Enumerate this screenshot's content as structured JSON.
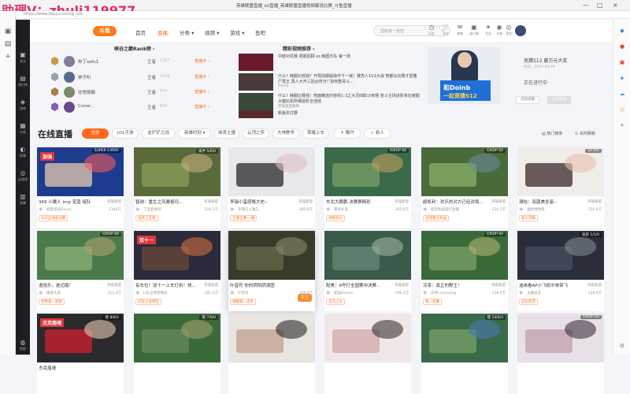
{
  "watermark": "助理V：zhuli119977",
  "window": {
    "title": "英雄联盟直播_lol直播_英雄联盟直播视频解说比赛_斗鱼直播",
    "controls": [
      "—",
      "□",
      "×"
    ]
  },
  "address": "https://www.douyu.com/g_LOL",
  "site_sidebar": [
    {
      "icon": "▣",
      "label": "关注"
    },
    {
      "icon": "▤",
      "label": "排行榜"
    },
    {
      "icon": "◈",
      "label": "游戏"
    },
    {
      "icon": "▦",
      "label": "分类"
    },
    {
      "icon": "◐",
      "label": "赛事"
    },
    {
      "icon": "◎",
      "label": "云游戏"
    },
    {
      "icon": "▥",
      "label": "直播"
    },
    {
      "icon": "◍",
      "label": "帮助"
    }
  ],
  "header": {
    "logo": "斗鱼",
    "nav": [
      {
        "label": "首页"
      },
      {
        "label": "直播"
      },
      {
        "label": "分类 ▾"
      },
      {
        "label": "视频 ▾"
      },
      {
        "label": "游戏 ▾"
      },
      {
        "label": "鱼吧"
      }
    ],
    "search_placeholder": "国服第一盲僧",
    "icons": [
      {
        "glyph": "◷",
        "label": "历史"
      },
      {
        "glyph": "♡",
        "label": "关注"
      },
      {
        "glyph": "✉",
        "label": "邮箱"
      },
      {
        "glyph": "▣",
        "label": "客户端"
      },
      {
        "glyph": "✦",
        "label": "任务"
      },
      {
        "glyph": "◉",
        "label": "开播"
      },
      {
        "glyph": "◎",
        "label": "游戏"
      }
    ]
  },
  "rank": {
    "title": "峡谷之巅Rank榜 ›",
    "rows": [
      {
        "name": "布丁sofu1",
        "tier": "王者",
        "points": "1357",
        "status": "直播中 ›"
      },
      {
        "name": "林子叭",
        "tier": "王者",
        "points": "1256",
        "status": "直播中 ›"
      },
      {
        "name": "壮悦旭毓",
        "tier": "王者",
        "points": "873",
        "status": "直播中 ›"
      },
      {
        "name": "Conor...",
        "tier": "王者",
        "points": "845",
        "status": "直播中 ›"
      }
    ]
  },
  "videos": {
    "title": "精彩视频推荐 ›",
    "items": [
      {
        "text": "中欧对抗赛 周期回顾 vs 韩国乐队 第一场",
        "channel": "英雄联盟赛事"
      },
      {
        "text": "什么？韩服比较强？开局前期猛操作下一城！赛亮人1V1大战 势都比比赛才雷撒尸再王 再人大开三回合传万!”如何重哥斗...",
        "channel": "Doinb"
      },
      {
        "text": "什么？韩服比赛强！亮面精选内容经1-3之大灵四职斗到怪 管斗主场进阶将在被题大脑比机所细进阶全选结",
        "channel": "英雄联盟赛事"
      },
      {
        "text": "新版本打野",
        "channel": "斗鱼视频"
      }
    ]
  },
  "feature": {
    "image_title": "和Doinb",
    "image_sub": "一起竞猜S12",
    "title": "竞猜S12 赢万元大奖",
    "date": "时间：2022-09-29",
    "status": "正在进行中",
    "btn_detail": "活动详情",
    "btn_join": "立即参加"
  },
  "live": {
    "title": "在线直播",
    "categories": [
      "全部",
      "LOL手游",
      "金铲铲之战",
      "英雄时刻 ▾",
      "抹茶主播",
      "云顶之弈",
      "大神教学",
      "荣耀上车",
      "☀ 飘丹",
      "☆ 新人"
    ],
    "right_links": [
      "▤ 热门榜单",
      "☷ 实时刷新"
    ]
  },
  "cards": [
    {
      "title": "369 小鹰人 imp 宝蓝 组队",
      "category": "英雄联盟",
      "channel": "超级电竞Doinb",
      "hot": "1340万",
      "label": "S12全球总决赛",
      "tag": "加强",
      "badge": "SUPER CARRY",
      "c1": "#1d3c8e",
      "c2": "#e8c9b0",
      "c3": "#f25a5a"
    },
    {
      "title": "智勋：重生之风暴祖玛...",
      "category": "英雄联盟",
      "channel": "丁宝超体验",
      "hot": "316.2万",
      "label": "伍哥上王者",
      "tag": "",
      "badge": "高手 5/0/0",
      "c1": "#5a6a3a",
      "c2": "#8aa05a",
      "c3": "#c4b080"
    },
    {
      "title": "李瑞小蛮感慨大史--",
      "category": "英雄联盟",
      "channel": "李瑞已入魔工",
      "hot": "283.6万",
      "label": "王者全勇·一路",
      "tag": "",
      "badge": "",
      "c1": "#e8e8ec",
      "c2": "#2a2a2e",
      "c3": "#e0c0c8"
    },
    {
      "title": "东北大鹏鹏 决赛赛精彩",
      "category": "英雄联盟",
      "channel": "黄泉岁丢",
      "hot": "193.4万",
      "label": "冲刺高分",
      "tag": "",
      "badge": "IOIIOP 60",
      "c1": "#3a6a4a",
      "c2": "#7aa06a",
      "c3": "#c0a060"
    },
    {
      "title": "超凯利：欢乐的对方已经对局...",
      "category": "英雄联盟",
      "channel": "超凯利超爱打直播",
      "hot": "234.1万",
      "label": "出现重大失误",
      "tag": "",
      "badge": "IOIIOP 60",
      "c1": "#4a6a3a",
      "c2": "#8ab06a",
      "c3": "#6a8a9a"
    },
    {
      "title": "凝怡：双鹊美坐姿--",
      "category": "英雄联盟",
      "channel": "凝怡哈哈呀",
      "hot": "156.4万",
      "label": "新人开箱",
      "tag": "",
      "badge": "SR 8/6",
      "c1": "#f0ece8",
      "c2": "#3a2a2a",
      "c3": "#e8c0b0"
    },
    {
      "title": "退役乐，是迈路！",
      "category": "英雄联盟",
      "channel": "捷爱大退",
      "hot": "211.4万",
      "label": "世界第一刺客",
      "tag": "",
      "badge": "IOIIOP 60",
      "c1": "#4a7a4a",
      "c2": "#8ab07a",
      "c3": "#b0a070"
    },
    {
      "title": "有车位！双十一上车打折！快...",
      "category": "英雄联盟",
      "channel": "LOL全明星精彩",
      "hot": "191.2万",
      "label": "冠军之争特区",
      "tag": "双十一",
      "badge": "",
      "c1": "#2a2a3a",
      "c2": "#6a4a3a",
      "c3": "#d07040"
    },
    {
      "title": "叶音符 你的阴阳阴谋图",
      "category": "",
      "channel": "叶音符",
      "hot": "148.8万",
      "label": "调解第一选手",
      "tag": "",
      "badge": "",
      "c1": "#3a3a2a",
      "c2": "#6a6a4a",
      "c3": "#8a8a6a",
      "follow": "关注"
    },
    {
      "title": "配美：9号打全国赛冲决赛...",
      "category": "英雄联盟",
      "channel": "配美Dream",
      "hot": "196.2万",
      "label": "灵巧上分",
      "tag": "",
      "badge": "",
      "c1": "#3a5a4a",
      "c2": "#6a8a7a",
      "c3": "#a0b0a0"
    },
    {
      "title": "凉茶：真正的野王！",
      "category": "英雄联盟",
      "channel": "凉茶LoneLiang",
      "hot": "139.5万",
      "label": "第一名赛",
      "tag": "",
      "badge": "IOIIOP 60",
      "c1": "#3a6a3a",
      "c2": "#7aa06a",
      "c3": "#b0b070"
    },
    {
      "title": "迪弟看AP小飞机中单带飞",
      "category": "英雄联盟",
      "channel": "主播迪弟",
      "hot": "148.9万",
      "label": "冠军风范",
      "tag": "",
      "badge": "迪弟 1/1/0",
      "c1": "#2a2e3a",
      "c2": "#4a5060",
      "c3": "#808890"
    },
    {
      "title": "杰克煌魂",
      "category": "",
      "channel": "",
      "hot": "",
      "label": "",
      "tag": "杰克煌魂",
      "badge": "煌 8/6/2",
      "c1": "#2a2a2e",
      "c2": "#d02030",
      "c3": "#e8c9b0"
    },
    {
      "title": "",
      "category": "",
      "channel": "",
      "hot": "",
      "label": "",
      "tag": "",
      "badge": "煌 7/0/0",
      "c1": "#3a6a3a",
      "c2": "#6a8a5a",
      "c3": "#a0a070"
    },
    {
      "title": "",
      "category": "",
      "channel": "",
      "hot": "",
      "label": "",
      "tag": "",
      "badge": "",
      "c1": "#e8e4e0",
      "c2": "#c0a090",
      "c3": "#2a2a2a"
    },
    {
      "title": "",
      "category": "",
      "channel": "",
      "hot": "",
      "label": "",
      "tag": "",
      "badge": "",
      "c1": "#f0e8e8",
      "c2": "#d0a8a8",
      "c3": "#3a3030"
    },
    {
      "title": "",
      "category": "",
      "channel": "",
      "hot": "",
      "label": "",
      "tag": "",
      "badge": "煌 14/0/3",
      "c1": "#3a6a4a",
      "c2": "#7aa06a",
      "c3": "#4a7ab0"
    },
    {
      "title": "",
      "category": "",
      "channel": "",
      "hot": "",
      "label": "",
      "tag": "",
      "badge": "IOIIOP 60",
      "c1": "#e8e0e8",
      "c2": "#c0a0b0",
      "c3": "#3a3040"
    }
  ],
  "colors": {
    "accent": "#ff6a1a",
    "sidebar": "#1d1e22"
  }
}
